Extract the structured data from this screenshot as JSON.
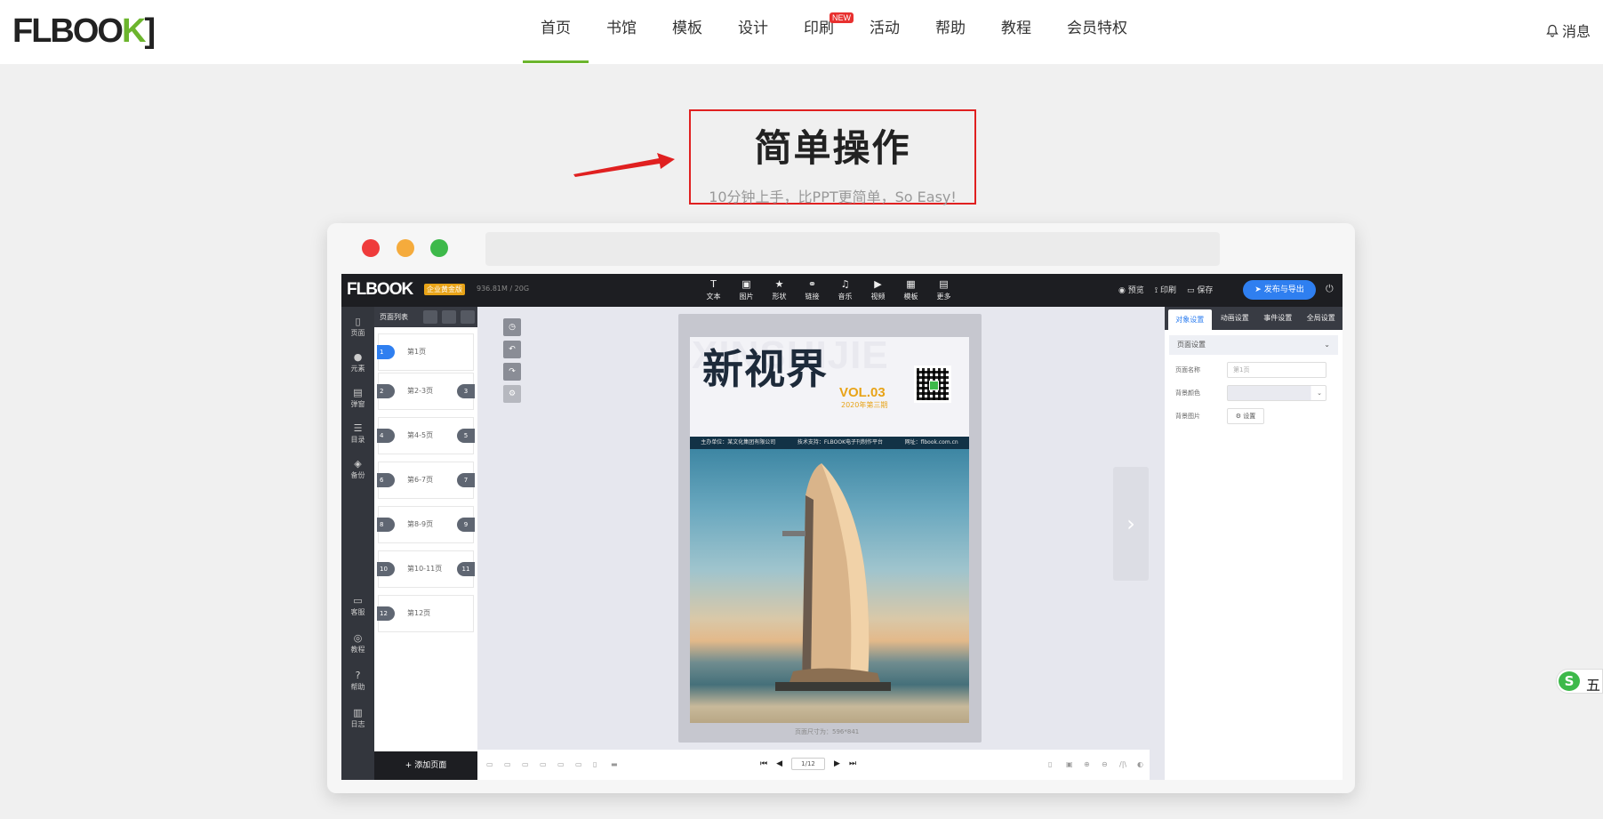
{
  "brand": {
    "logo": "FLBOOK",
    "accent": "#6cb52d"
  },
  "nav": {
    "items": [
      {
        "label": "首页",
        "active": true
      },
      {
        "label": "书馆"
      },
      {
        "label": "模板"
      },
      {
        "label": "设计"
      },
      {
        "label": "印刷",
        "badge": "NEW"
      },
      {
        "label": "活动"
      },
      {
        "label": "帮助"
      },
      {
        "label": "教程"
      },
      {
        "label": "会员特权"
      }
    ],
    "message": "消息"
  },
  "hero": {
    "title": "简单操作",
    "subtitle": "10分钟上手，比PPT更简单，So Easy!"
  },
  "editor": {
    "logo": "FLBOOK",
    "edition_badge": "企业黄金版",
    "storage": "936.81M / 20G",
    "tools": [
      {
        "label": "文本",
        "icon": "text-icon"
      },
      {
        "label": "图片",
        "icon": "image-icon"
      },
      {
        "label": "形状",
        "icon": "star-icon"
      },
      {
        "label": "链接",
        "icon": "link-icon"
      },
      {
        "label": "音乐",
        "icon": "music-icon"
      },
      {
        "label": "视频",
        "icon": "video-icon"
      },
      {
        "label": "模板",
        "icon": "template-icon"
      },
      {
        "label": "更多",
        "icon": "more-icon"
      }
    ],
    "preview": "预览",
    "print": "印刷",
    "save": "保存",
    "publish": "发布与导出",
    "sidebar_top": [
      "页面",
      "元素",
      "弹窗",
      "目录",
      "备份"
    ],
    "sidebar_bottom": [
      "客服",
      "教程",
      "帮助",
      "日志"
    ],
    "page_list_title": "页面列表",
    "pages": [
      {
        "num": "1",
        "label": "第1页"
      },
      {
        "num": "2",
        "label": "第2-3页",
        "num2": "3"
      },
      {
        "num": "4",
        "label": "第4-5页",
        "num2": "5"
      },
      {
        "num": "6",
        "label": "第6-7页",
        "num2": "7"
      },
      {
        "num": "8",
        "label": "第8-9页",
        "num2": "9"
      },
      {
        "num": "10",
        "label": "第10-11页",
        "num2": "11"
      },
      {
        "num": "12",
        "label": "第12页"
      }
    ],
    "add_page": "添加页面",
    "cover": {
      "bg_text": "XINSHIJIE",
      "title": "新视界",
      "vol": "VOL.03",
      "issue": "2020年第三期",
      "band": [
        "主办单位：某文化集团有限公司",
        "技术支持：FLBOOK电子刊制作平台",
        "网址：flbook.com.cn"
      ]
    },
    "page_size": "页面尺寸为：596*841",
    "pager": "1/12",
    "right_tabs": [
      "对象设置",
      "动画设置",
      "事件设置",
      "全局设置"
    ],
    "section_title": "页面设置",
    "fields": {
      "page_name_label": "页面名称",
      "page_name_value": "第1页",
      "bg_color_label": "背景颜色",
      "bg_image_label": "背景图片",
      "bg_image_button": "设置"
    }
  },
  "ime": {
    "label": "五"
  }
}
